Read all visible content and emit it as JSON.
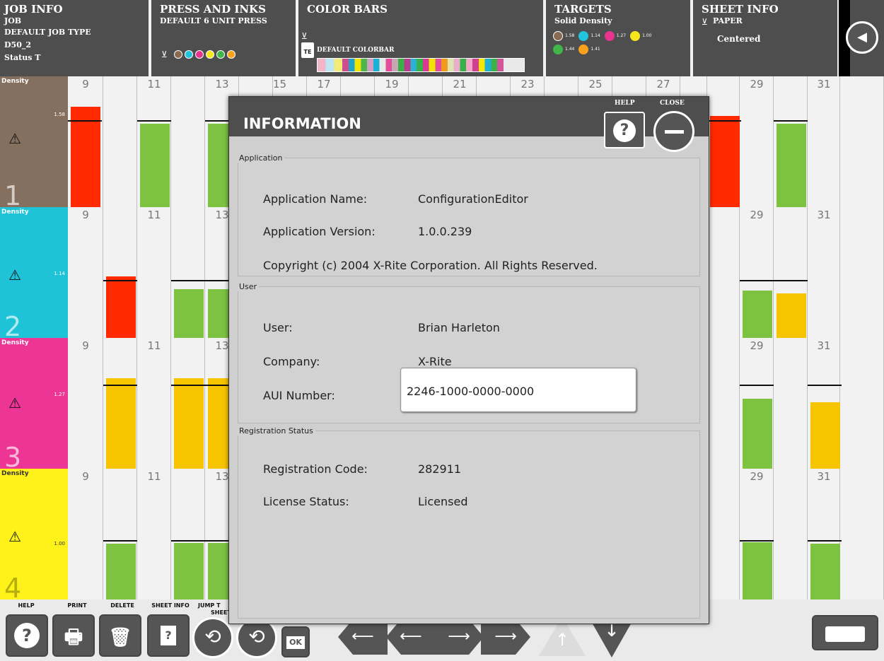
{
  "header": {
    "job_info": {
      "title": "JOB INFO",
      "lines": [
        "JOB",
        "DEFAULT JOB TYPE",
        "D50_2",
        "Status T"
      ]
    },
    "press_inks": {
      "title": "PRESS AND INKS",
      "press": "DEFAULT 6 UNIT PRESS",
      "ink_colors": [
        "#8b6a52",
        "#22c4dc",
        "#e8338f",
        "#f7e61c",
        "#3fb54a",
        "#f7a21b"
      ]
    },
    "color_bars": {
      "title": "COLOR BARS",
      "bar_name": "DEFAULT COLORBAR",
      "te_label": "TE"
    },
    "targets": {
      "title": "TARGETS",
      "subtitle": "Solid Density",
      "items": [
        {
          "color": "#8b6a52",
          "value": "1.58"
        },
        {
          "color": "#22c4dc",
          "value": "1.14"
        },
        {
          "color": "#e8338f",
          "value": "1.27"
        },
        {
          "color": "#f7e61c",
          "value": "1.00"
        },
        {
          "color": "#3fb54a",
          "value": "1.44"
        },
        {
          "color": "#f7a21b",
          "value": "1.41"
        }
      ]
    },
    "sheet_info": {
      "title": "SHEET INFO",
      "paper": "PAPER",
      "position": "Centered"
    }
  },
  "zone_header_numbers": [
    "9",
    "11",
    "13",
    "15",
    "17",
    "19",
    "21",
    "23",
    "25",
    "27",
    "29",
    "31"
  ],
  "rows": [
    {
      "label": "Density",
      "number": "1",
      "color": "#85705f",
      "target": "1.58"
    },
    {
      "label": "Density",
      "number": "2",
      "color": "#1ec3d8",
      "target": "1.14"
    },
    {
      "label": "Density",
      "number": "3",
      "color": "#ec3594",
      "target": "1.27"
    },
    {
      "label": "Density",
      "number": "4",
      "color": "#fff21a",
      "target": "1.00"
    }
  ],
  "row_zone_labels": {
    "left": [
      "9",
      "11",
      "13"
    ],
    "right": [
      "29",
      "31"
    ]
  },
  "bottom_toolbar": {
    "labels": {
      "help": "HELP",
      "print": "PRINT",
      "delete": "DELETE",
      "sheet_info": "SHEET INFO",
      "jump": "JUMP T",
      "jump2": "SHEET"
    },
    "ok_label": "OK"
  },
  "modal": {
    "title": "INFORMATION",
    "help_label": "HELP",
    "close_label": "CLOSE",
    "application": {
      "legend": "Application",
      "name_label": "Application Name:",
      "name_value": "ConfigurationEditor",
      "version_label": "Application Version:",
      "version_value": "1.0.0.239",
      "copyright": "Copyright (c) 2004 X-Rite Corporation.  All Rights Reserved."
    },
    "user": {
      "legend": "User",
      "user_label": "User:",
      "user_value": "Brian Harleton",
      "company_label": "Company:",
      "company_value": "X-Rite",
      "aui_label": "AUI Number:",
      "aui_value": "2246-1000-0000-0000"
    },
    "registration": {
      "legend": "Registration Status",
      "code_label": "Registration Code:",
      "code_value": "282911",
      "license_label": "License Status:",
      "license_value": "Licensed"
    }
  },
  "colors": {
    "red": "#ff2a00",
    "green": "#7ec242",
    "orange": "#f7c400",
    "panel_dark": "#4e4e4e"
  }
}
